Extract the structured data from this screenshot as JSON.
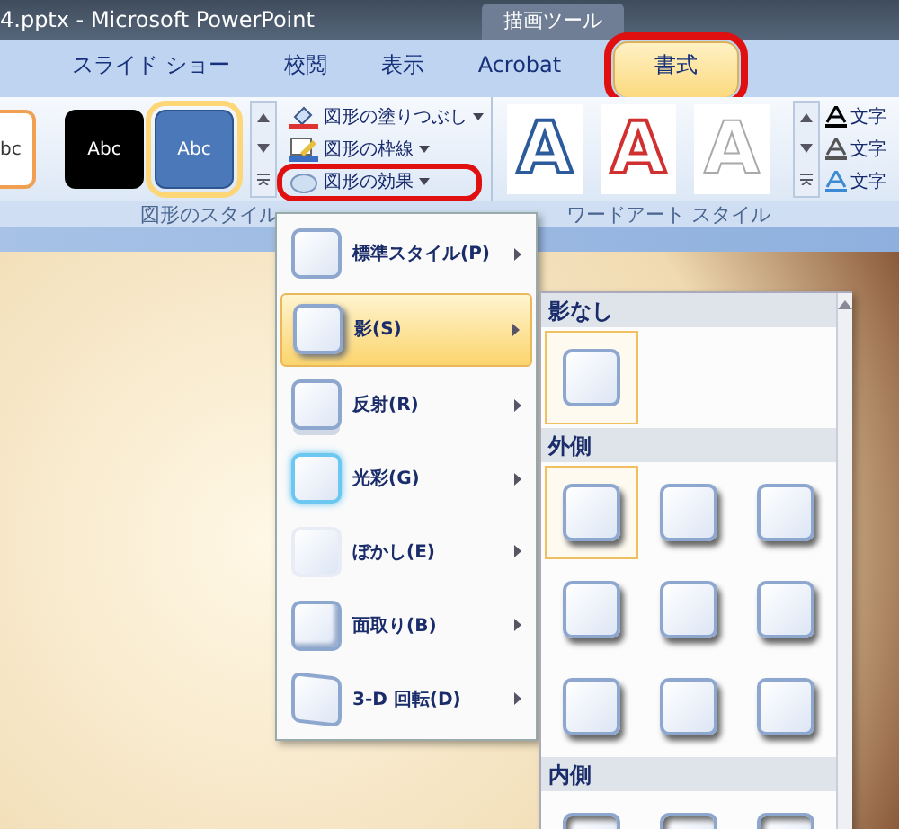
{
  "window": {
    "title": "4.pptx - Microsoft PowerPoint",
    "context_tab": "描画ツール"
  },
  "tabs": [
    {
      "label": "スライド ショー",
      "selected": false,
      "highlighted": false
    },
    {
      "label": "校閲",
      "selected": false,
      "highlighted": false
    },
    {
      "label": "表示",
      "selected": false,
      "highlighted": false
    },
    {
      "label": "Acrobat",
      "selected": false,
      "highlighted": false
    },
    {
      "label": "書式",
      "selected": true,
      "highlighted": true
    }
  ],
  "shape_styles": {
    "label": "図形のスタイル",
    "gallery": [
      {
        "text": "bc",
        "kind": "outline",
        "selected": false
      },
      {
        "text": "Abc",
        "kind": "dark",
        "selected": false
      },
      {
        "text": "Abc",
        "kind": "blue",
        "selected": true
      }
    ],
    "commands": [
      {
        "label": "図形の塗りつぶし",
        "kind": "fill",
        "highlighted": false
      },
      {
        "label": "図形の枠線",
        "kind": "outline",
        "highlighted": false
      },
      {
        "label": "図形の効果",
        "kind": "effect",
        "highlighted": true
      }
    ]
  },
  "wordart_styles": {
    "label": "ワードアート スタイル",
    "gallery": [
      {
        "text": "A",
        "kind": "blue"
      },
      {
        "text": "A",
        "kind": "red"
      },
      {
        "text": "A",
        "kind": "white"
      }
    ],
    "commands": [
      {
        "label": "文字",
        "kind": "fill"
      },
      {
        "label": "文字",
        "kind": "outline"
      },
      {
        "label": "文字",
        "kind": "effect"
      }
    ]
  },
  "effects_menu": [
    {
      "label": "標準スタイル(P)",
      "kind": "preset",
      "selected": false
    },
    {
      "label": "影(S)",
      "kind": "shadow",
      "selected": true
    },
    {
      "label": "反射(R)",
      "kind": "reflection",
      "selected": false
    },
    {
      "label": "光彩(G)",
      "kind": "glow",
      "selected": false
    },
    {
      "label": "ぼかし(E)",
      "kind": "soft",
      "selected": false
    },
    {
      "label": "面取り(B)",
      "kind": "bevel",
      "selected": false
    },
    {
      "label": "3-D 回転(D)",
      "kind": "rotate",
      "selected": false
    }
  ],
  "shadow_submenu": [
    {
      "heading": "影なし",
      "items": [
        {
          "selected": true
        }
      ]
    },
    {
      "heading": "外側",
      "items": [
        {
          "selected": true
        },
        {
          "selected": false
        },
        {
          "selected": false
        },
        {
          "selected": false
        },
        {
          "selected": false
        },
        {
          "selected": false
        },
        {
          "selected": false
        },
        {
          "selected": false
        },
        {
          "selected": false
        }
      ]
    },
    {
      "heading": "内側",
      "items": [
        {
          "selected": false
        },
        {
          "selected": false
        },
        {
          "selected": false
        }
      ]
    }
  ]
}
